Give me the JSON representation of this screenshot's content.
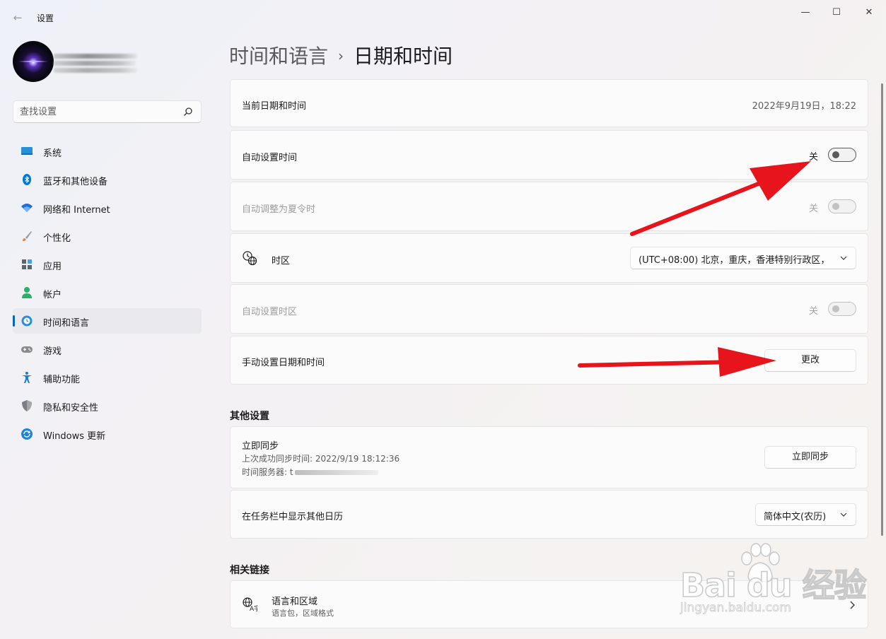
{
  "window": {
    "title": "设置"
  },
  "titlebar": {
    "back": "←",
    "min": "—",
    "max": "☐",
    "close": "✕"
  },
  "sidebar": {
    "search": {
      "placeholder": "查找设置"
    },
    "items": [
      {
        "label": "系统",
        "icon": "monitor-icon",
        "color": "#2a8fd6"
      },
      {
        "label": "蓝牙和其他设备",
        "icon": "bluetooth-icon",
        "color": "#0078d4"
      },
      {
        "label": "网络和 Internet",
        "icon": "wifi-icon",
        "color": "#1f6fd1"
      },
      {
        "label": "个性化",
        "icon": "brush-icon",
        "color": "#e0853c"
      },
      {
        "label": "应用",
        "icon": "apps-icon",
        "color": "#5b6470"
      },
      {
        "label": "帐户",
        "icon": "person-icon",
        "color": "#2bb06b"
      },
      {
        "label": "时间和语言",
        "icon": "globe-clock-icon",
        "color": "#2a8fd6",
        "active": true
      },
      {
        "label": "游戏",
        "icon": "gamepad-icon",
        "color": "#8a8a8a"
      },
      {
        "label": "辅助功能",
        "icon": "accessibility-icon",
        "color": "#1f7ad6"
      },
      {
        "label": "隐私和安全性",
        "icon": "shield-icon",
        "color": "#7a7f87"
      },
      {
        "label": "Windows 更新",
        "icon": "update-icon",
        "color": "#1f86d6"
      }
    ]
  },
  "main": {
    "breadcrumb": {
      "parent": "时间和语言",
      "separator": "›",
      "current": "日期和时间"
    },
    "current_datetime": {
      "label": "当前日期和时间",
      "value": "2022年9月19日，18:22"
    },
    "auto_time": {
      "label": "自动设置时间",
      "state": "关"
    },
    "auto_dst": {
      "label": "自动调整为夏令时",
      "state": "关"
    },
    "timezone": {
      "label": "时区",
      "value": "(UTC+08:00) 北京，重庆，香港特别行政区，"
    },
    "auto_timezone": {
      "label": "自动设置时区",
      "state": "关"
    },
    "manual": {
      "label": "手动设置日期和时间",
      "button": "更改"
    },
    "other_settings": {
      "title": "其他设置",
      "sync": {
        "title": "立即同步",
        "last_sync": "上次成功同步时间: 2022/9/19 18:12:36",
        "server_label": "时间服务器: t",
        "button": "立即同步"
      },
      "calendar": {
        "label": "在任务栏中显示其他日历",
        "value": "简体中文(农历)"
      }
    },
    "related": {
      "title": "相关链接",
      "language_region": {
        "title": "语言和区域",
        "subtitle": "语言包，区域格式"
      }
    }
  },
  "watermark": {
    "main": "Bai du 经验",
    "sub": "jingyan.baidu.com"
  },
  "colors": {
    "accent": "#0067c0",
    "annotation_arrow": "#e8141b"
  }
}
